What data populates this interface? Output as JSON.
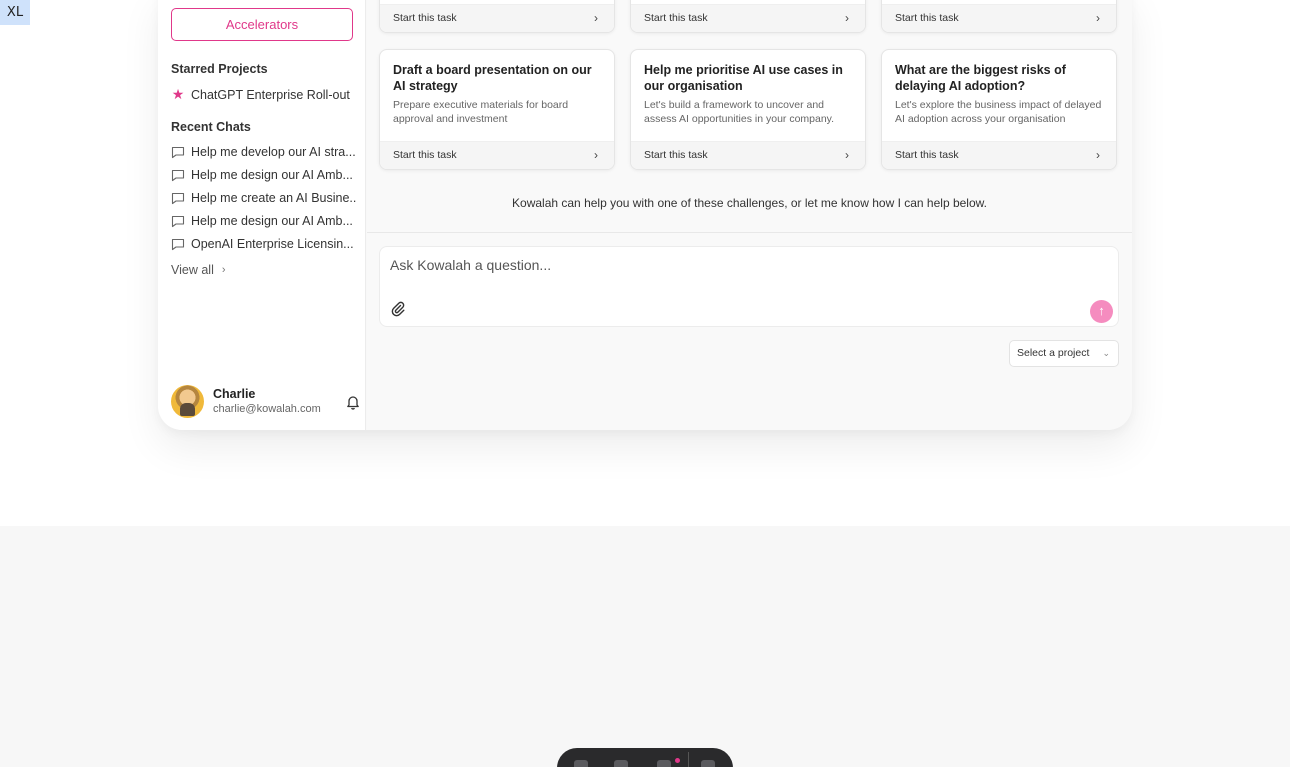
{
  "badge": "XL",
  "sidebar": {
    "accelerators_label": "Accelerators",
    "starred_heading": "Starred Projects",
    "starred": [
      {
        "label": "ChatGPT Enterprise Roll-out",
        "icon": "star-icon"
      }
    ],
    "recent_heading": "Recent Chats",
    "recent": [
      {
        "label": "Help me develop our AI stra..."
      },
      {
        "label": "Help me design our AI Amb..."
      },
      {
        "label": "Help me create an AI Busine..."
      },
      {
        "label": "Help me design our AI Amb..."
      },
      {
        "label": "OpenAI Enterprise Licensin..."
      }
    ],
    "view_all": "View all",
    "user": {
      "name": "Charlie",
      "email": "charlie@kowalah.com"
    }
  },
  "main": {
    "top_cards": [
      {
        "footer": "Start this task"
      },
      {
        "footer": "Start this task"
      },
      {
        "footer": "Start this task"
      }
    ],
    "cards": [
      {
        "title": "Draft a board presentation on our AI strategy",
        "desc": "Prepare executive materials for board approval and investment",
        "footer": "Start this task"
      },
      {
        "title": "Help me prioritise AI use cases in our organisation",
        "desc": "Let's build a framework to uncover and assess AI opportunities in your company.",
        "footer": "Start this task"
      },
      {
        "title": "What are the biggest risks of delaying AI adoption?",
        "desc": "Let's explore the business impact of delayed AI adoption across your organisation",
        "footer": "Start this task"
      }
    ],
    "helper_text": "Kowalah can help you with one of these challenges, or let me know how I can help below.",
    "ask": {
      "placeholder": "Ask Kowalah a question...",
      "value": ""
    },
    "project_select": "Select a project"
  },
  "colors": {
    "accent": "#e0388a",
    "send_button": "#f58cbf"
  }
}
